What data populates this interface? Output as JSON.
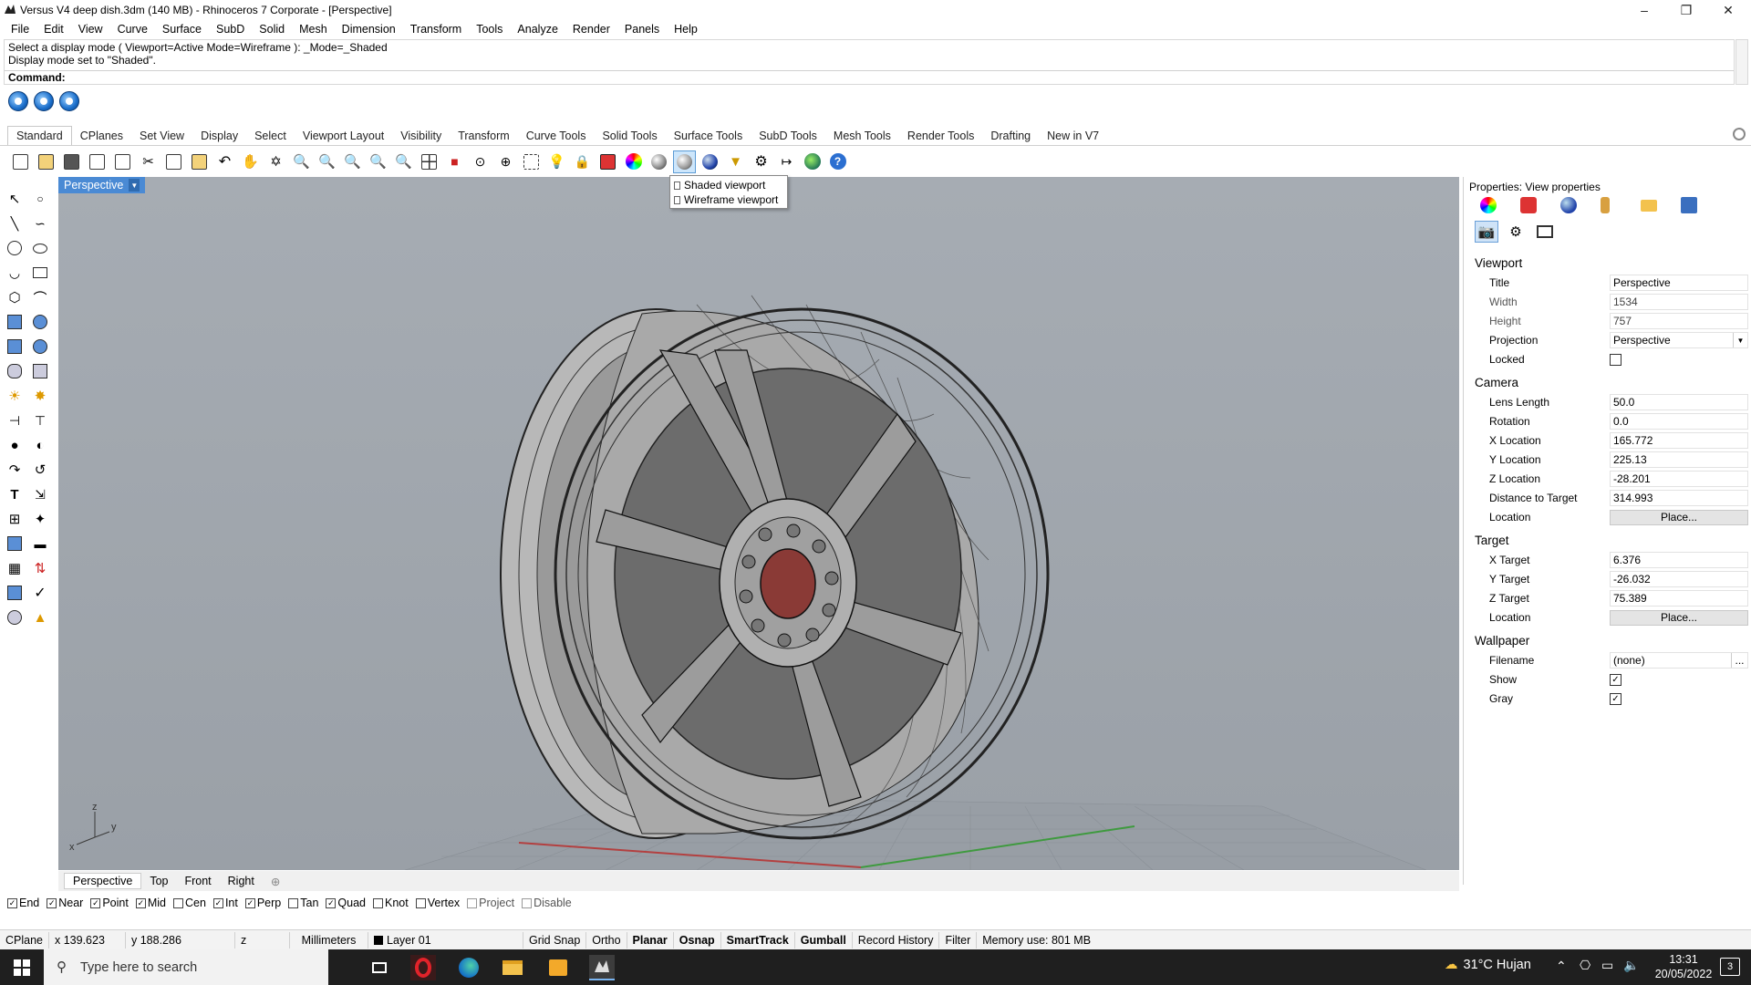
{
  "window": {
    "title": "Versus V4 deep dish.3dm (140 MB) - Rhinoceros 7 Corporate - [Perspective]"
  },
  "menu": [
    "File",
    "Edit",
    "View",
    "Curve",
    "Surface",
    "SubD",
    "Solid",
    "Mesh",
    "Dimension",
    "Transform",
    "Tools",
    "Analyze",
    "Render",
    "Panels",
    "Help"
  ],
  "command_history": {
    "line1": "Select a display mode ( Viewport=Active  Mode=Wireframe ): _Mode=_Shaded",
    "line2": "Display mode set to \"Shaded\".",
    "prompt": "Command:"
  },
  "toolbar_tabs": [
    "Standard",
    "CPlanes",
    "Set View",
    "Display",
    "Select",
    "Viewport Layout",
    "Visibility",
    "Transform",
    "Curve Tools",
    "Solid Tools",
    "Surface Tools",
    "SubD Tools",
    "Mesh Tools",
    "Render Tools",
    "Drafting",
    "New in V7"
  ],
  "popup_menu": {
    "item1": "Shaded viewport",
    "item2": "Wireframe viewport"
  },
  "viewport": {
    "name": "Perspective",
    "axis_z": "z",
    "axis_x": "x",
    "axis_y": "y"
  },
  "viewport_tabs": [
    "Perspective",
    "Top",
    "Front",
    "Right"
  ],
  "osnaps": [
    {
      "label": "End",
      "checked": true
    },
    {
      "label": "Near",
      "checked": true
    },
    {
      "label": "Point",
      "checked": true
    },
    {
      "label": "Mid",
      "checked": true
    },
    {
      "label": "Cen",
      "checked": false
    },
    {
      "label": "Int",
      "checked": true
    },
    {
      "label": "Perp",
      "checked": true
    },
    {
      "label": "Tan",
      "checked": false
    },
    {
      "label": "Quad",
      "checked": true
    },
    {
      "label": "Knot",
      "checked": false
    },
    {
      "label": "Vertex",
      "checked": false
    },
    {
      "label": "Project",
      "checked": false
    },
    {
      "label": "Disable",
      "checked": false
    }
  ],
  "status": {
    "cplane": "CPlane",
    "x": "x 139.623",
    "y": "y 188.286",
    "z": "z",
    "units": "Millimeters",
    "layer": "Layer 01",
    "grid_snap": "Grid Snap",
    "ortho": "Ortho",
    "planar": "Planar",
    "osnap": "Osnap",
    "smarttrack": "SmartTrack",
    "gumball": "Gumball",
    "record_history": "Record History",
    "filter": "Filter",
    "memory": "Memory use: 801 MB"
  },
  "properties": {
    "header": "Properties: View properties",
    "viewport_section": "Viewport",
    "title_label": "Title",
    "title_value": "Perspective",
    "width_label": "Width",
    "width_value": "1534",
    "height_label": "Height",
    "height_value": "757",
    "projection_label": "Projection",
    "projection_value": "Perspective",
    "locked_label": "Locked",
    "camera_section": "Camera",
    "lens_label": "Lens Length",
    "lens_value": "50.0",
    "rotation_label": "Rotation",
    "rotation_value": "0.0",
    "xloc_label": "X Location",
    "xloc_value": "165.772",
    "yloc_label": "Y Location",
    "yloc_value": "225.13",
    "zloc_label": "Z Location",
    "zloc_value": "-28.201",
    "dist_label": "Distance to Target",
    "dist_value": "314.993",
    "location_label": "Location",
    "place_button": "Place...",
    "target_section": "Target",
    "xt_label": "X Target",
    "xt_value": "6.376",
    "yt_label": "Y Target",
    "yt_value": "-26.032",
    "zt_label": "Z Target",
    "zt_value": "75.389",
    "tlocation_label": "Location",
    "tplace_button": "Place...",
    "wallpaper_section": "Wallpaper",
    "filename_label": "Filename",
    "filename_value": "(none)",
    "browse_button": "...",
    "show_label": "Show",
    "gray_label": "Gray"
  },
  "taskbar": {
    "search_placeholder": "Type here to search",
    "weather": "31°C  Hujan",
    "time": "13:31",
    "date": "20/05/2022",
    "notifications": "3"
  }
}
